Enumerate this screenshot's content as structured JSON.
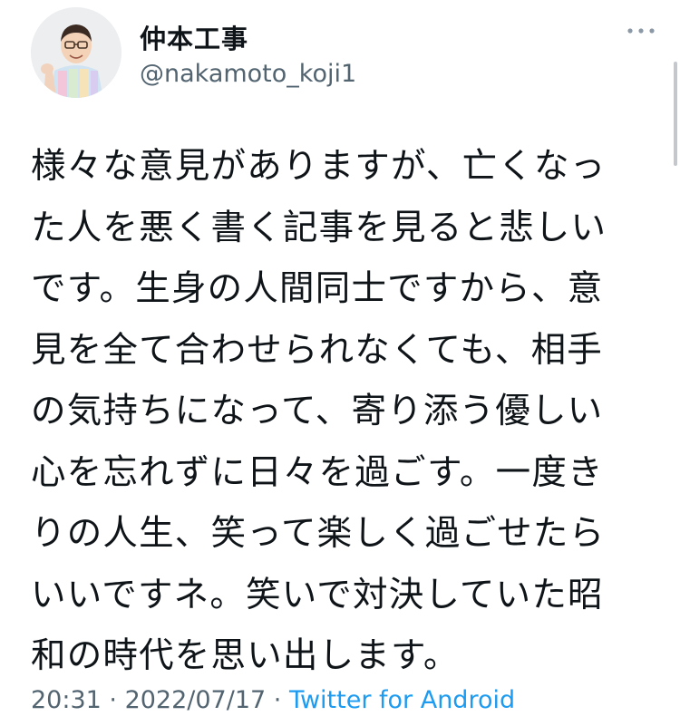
{
  "user": {
    "display_name": "仲本工事",
    "handle": "@nakamoto_koji1",
    "avatar_icon": "avatar-photo"
  },
  "tweet": {
    "text": "様々な意見がありますが、亡くなっ\nた人を悪く書く記事を見ると悲しい\nです。生身の人間同士ですから、意\n見を全て合わせられなくても、相手\nの気持ちになって、寄り添う優しい\n心を忘れずに日々を過ごす。一度き\nりの人生、笑って楽しく過ごせたら\nいいですネ。笑いで対決していた昭\n和の時代を思い出します。"
  },
  "meta": {
    "time": "20:31",
    "sep1": " · ",
    "date": "2022/07/17",
    "sep2": " · ",
    "source": "Twitter for Android"
  },
  "icons": {
    "more": "more-horizontal-icon"
  },
  "colors": {
    "text": "#0f1419",
    "secondary": "#536471",
    "link": "#1d9bf0"
  }
}
